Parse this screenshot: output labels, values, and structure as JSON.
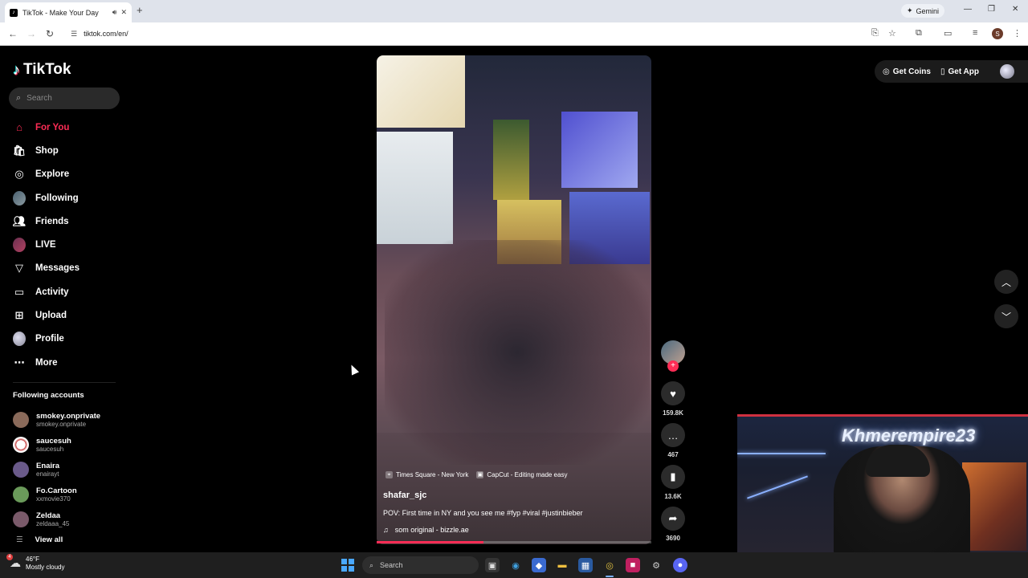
{
  "browser": {
    "tab_title": "TikTok - Make Your Day",
    "gemini_label": "Gemini",
    "url": "tiktok.com/en/",
    "profile_initial": "S"
  },
  "tiktok": {
    "logo_text": "TikTok",
    "search_placeholder": "Search",
    "nav": [
      {
        "label": "For You",
        "icon": "home-icon",
        "active": true
      },
      {
        "label": "Shop",
        "icon": "shop-icon"
      },
      {
        "label": "Explore",
        "icon": "compass-icon"
      },
      {
        "label": "Following",
        "icon": "avatar-icon"
      },
      {
        "label": "Friends",
        "icon": "friends-icon"
      },
      {
        "label": "LIVE",
        "icon": "live-icon"
      },
      {
        "label": "Messages",
        "icon": "messages-icon"
      },
      {
        "label": "Activity",
        "icon": "activity-icon"
      },
      {
        "label": "Upload",
        "icon": "upload-icon"
      },
      {
        "label": "Profile",
        "icon": "profile-icon"
      },
      {
        "label": "More",
        "icon": "more-icon"
      }
    ],
    "following_title": "Following accounts",
    "accounts": [
      {
        "name": "smokey.onprivate",
        "handle": "smokey.onprivate",
        "color": "#8a6a5a"
      },
      {
        "name": "saucesuh",
        "handle": "saucesuh",
        "color": "#eeeeee"
      },
      {
        "name": "Enaira",
        "handle": "enairayt",
        "color": "#6a5a8a"
      },
      {
        "name": "Fo.Cartoon",
        "handle": "xxmovie370",
        "color": "#6a9a5a"
      },
      {
        "name": "Zeldaa",
        "handle": "zeldaaa_45",
        "color": "#7a5a6a"
      }
    ],
    "view_all": "View all",
    "top_right": {
      "get_coins": "Get Coins",
      "get_app": "Get App"
    },
    "video": {
      "location_tag": "Times Square - New York",
      "capcut_tag": "CapCut - Editing made easy",
      "username": "shafar_sjc",
      "description": "POV: First time in NY and you see me #fyp #viral #justinbieber",
      "sound": "som original - bizzle.ae",
      "progress": 0.39
    },
    "actions": {
      "likes": "159.8K",
      "comments": "467",
      "saves": "13.6K",
      "shares": "3690"
    }
  },
  "webcam": {
    "neon_text": "Khmerempire23"
  },
  "taskbar": {
    "temperature": "46°F",
    "weather": "Mostly cloudy",
    "weather_badge": "4",
    "search_placeholder": "Search"
  },
  "colors": {
    "accent": "#fe2c55",
    "background": "#000000"
  }
}
